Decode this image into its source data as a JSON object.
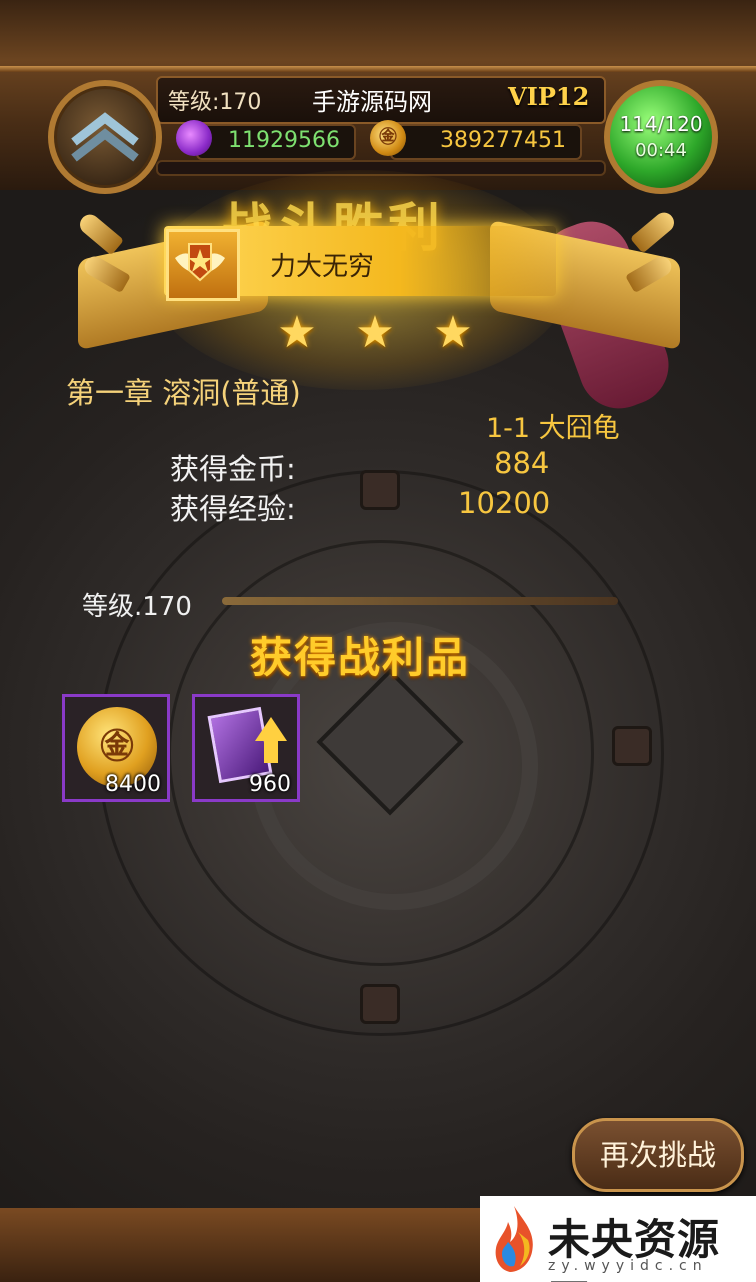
{
  "header": {
    "level": "等级:170",
    "player_name": "手游源码网",
    "vip": "VIP12",
    "gems": "11929566",
    "gold": "389277451",
    "coin_glyph": "㊎",
    "energy": "114/120",
    "energy_timer": "00:44"
  },
  "victory": {
    "title": "战斗胜利",
    "skill_name": "力大无穷",
    "stars": 3,
    "star_glyph": "★"
  },
  "result": {
    "chapter": "第一章 溶洞(普通)",
    "stage": "1-1 大囧龟",
    "gold_label": "获得金币:",
    "gold_value": "884",
    "exp_label": "获得经验:",
    "exp_value": "10200",
    "level": "等级.170"
  },
  "loot": {
    "title": "获得战利品",
    "items": [
      {
        "icon": "gold-coin-icon",
        "qty": "8400"
      },
      {
        "icon": "card-upgrade-icon",
        "qty": "960"
      }
    ]
  },
  "actions": {
    "rechallenge": "再次挑战"
  },
  "watermark": {
    "text": "未央资源网",
    "sub": "zy.wyyidc.cn"
  },
  "colors": {
    "gold_text": "#f7c640",
    "loot_border": "#8a3ac8",
    "energy_orb": "#2ea82a"
  }
}
